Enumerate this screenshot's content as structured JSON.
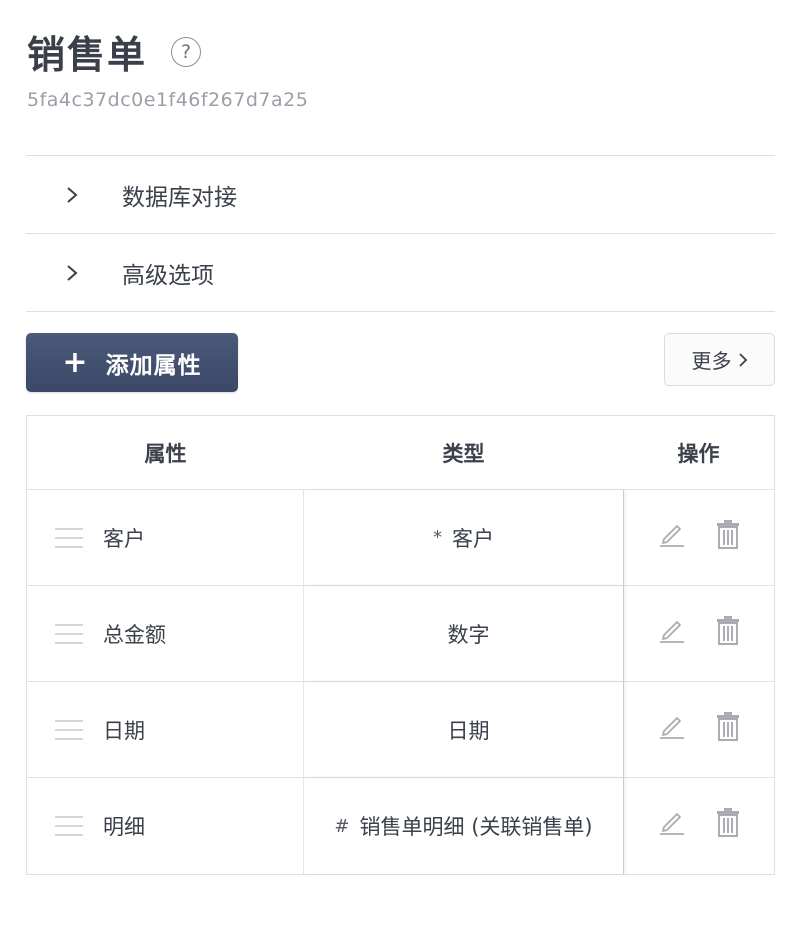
{
  "page": {
    "title": "销售单",
    "object_id": "5fa4c37dc0e1f46f267d7a25",
    "help_icon": "?"
  },
  "sections": [
    {
      "label": "数据库对接",
      "icon": "chevron-right-icon",
      "expanded": false
    },
    {
      "label": "高级选项",
      "icon": "chevron-right-icon",
      "expanded": false
    }
  ],
  "toolbar": {
    "add_icon": "+",
    "add_label": "添加属性",
    "more_label": "更多"
  },
  "table": {
    "headers": {
      "attr": "属性",
      "type": "类型",
      "ops": "操作"
    },
    "rows": [
      {
        "name": "客户",
        "type_prefix": "*",
        "type": "客户"
      },
      {
        "name": "总金额",
        "type_prefix": "",
        "type": "数字"
      },
      {
        "name": "日期",
        "type_prefix": "",
        "type": "日期"
      },
      {
        "name": "明细",
        "type_prefix": "#",
        "type": "销售单明细 (关联销售单)"
      }
    ]
  },
  "colors": {
    "primary_button": "#44516f",
    "border": "#dedfe3",
    "icon_gray": "#a9adb3"
  }
}
